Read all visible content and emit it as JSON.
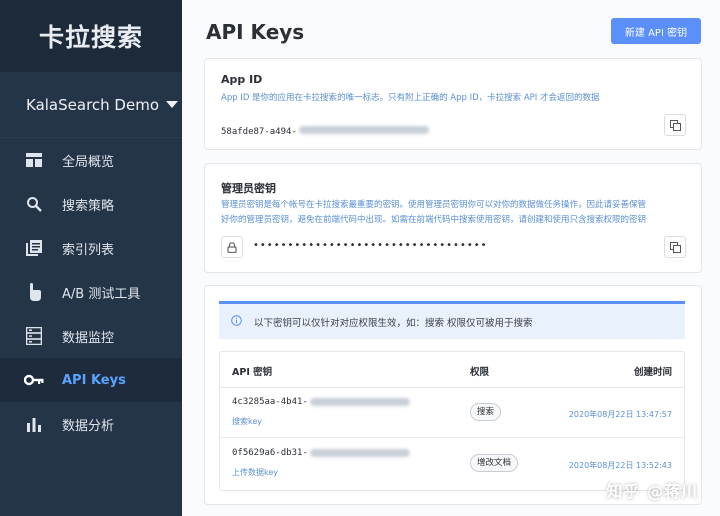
{
  "sidebar": {
    "brand": "卡拉搜索",
    "app_name": "KalaSearch Demo",
    "items": [
      {
        "label": "全局概览",
        "icon": "dashboard-icon"
      },
      {
        "label": "搜索策略",
        "icon": "search-icon"
      },
      {
        "label": "索引列表",
        "icon": "list-icon"
      },
      {
        "label": "A/B 测试工具",
        "icon": "pointer-hand-icon"
      },
      {
        "label": "数据监控",
        "icon": "server-icon"
      },
      {
        "label": "API Keys",
        "icon": "key-icon",
        "active": true
      },
      {
        "label": "数据分析",
        "icon": "bar-chart-icon"
      }
    ]
  },
  "page": {
    "title": "API Keys",
    "new_key_button": "新建 API 密钥"
  },
  "app_id": {
    "title": "App ID",
    "desc": "App ID 是你的应用在卡拉搜索的唯一标志。只有附上正确的 App ID，卡拉搜索 API 才会返回的数据",
    "value": "58afde87-a494-"
  },
  "admin_key": {
    "title": "管理员密钥",
    "desc_line1": "管理员密钥是每个帐号在卡拉搜索最重要的密钥。使用管理员密钥你可以对你的数据做任务操作，因此请妥善保管",
    "desc_line2": "好你的管理员密钥，避免在前端代码中出现。如需在前端代码中搜索使用密钥，请创建和使用只含搜索权限的密钥",
    "masked": "••••••••••••••••••••••••••••••••••"
  },
  "keys": {
    "notice": "以下密钥可以仅针对对应权限生效，如：搜索 权限仅可被用于搜索",
    "headers": {
      "key": "API 密钥",
      "perm": "权限",
      "created": "创建时间"
    },
    "rows": [
      {
        "key": "4c3285aa-4b41-",
        "desc": "搜索key",
        "perm": "搜索",
        "created": "2020年08月22日 13:47:57"
      },
      {
        "key": "0f5629a6-db31-",
        "desc": "上传数据key",
        "perm": "增改文档",
        "created": "2020年08月22日 13:52:43"
      }
    ]
  },
  "watermark": "知乎 @蒋川",
  "colors": {
    "sidebar_bg": "#253548",
    "accent": "#5b8ff9",
    "link_text": "#5b8fd4"
  }
}
